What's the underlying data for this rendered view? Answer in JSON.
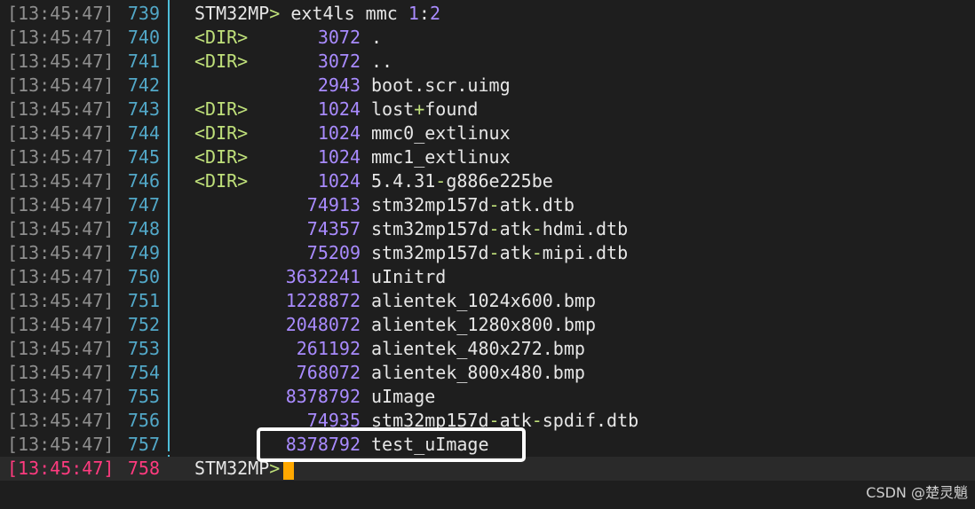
{
  "colors": {
    "background": "#1e1e1e",
    "timestamp": "#8f8f8f",
    "line_number": "#52a8c8",
    "current_line": "#ff3b7f",
    "dir_tag": "#bfe07a",
    "size": "#a98bff",
    "text": "#e6e6e6",
    "cursor": "#ffa800",
    "highlight_box": "#ffffff"
  },
  "command_line": {
    "timestamp": "[13:45:47]",
    "number": "739",
    "prompt": "STM32MP",
    "gt": ">",
    "command": " ext4ls mmc ",
    "arg_a": "1",
    "colon": ":",
    "arg_b": "2"
  },
  "entries": [
    {
      "timestamp": "[13:45:47]",
      "number": "740",
      "dir": "<DIR>",
      "size": "3072",
      "name": "."
    },
    {
      "timestamp": "[13:45:47]",
      "number": "741",
      "dir": "<DIR>",
      "size": "3072",
      "name": ".."
    },
    {
      "timestamp": "[13:45:47]",
      "number": "742",
      "dir": "",
      "size": "2943",
      "name": "boot.scr.uimg"
    },
    {
      "timestamp": "[13:45:47]",
      "number": "743",
      "dir": "<DIR>",
      "size": "1024",
      "name": "lost+found"
    },
    {
      "timestamp": "[13:45:47]",
      "number": "744",
      "dir": "<DIR>",
      "size": "1024",
      "name": "mmc0_extlinux"
    },
    {
      "timestamp": "[13:45:47]",
      "number": "745",
      "dir": "<DIR>",
      "size": "1024",
      "name": "mmc1_extlinux"
    },
    {
      "timestamp": "[13:45:47]",
      "number": "746",
      "dir": "<DIR>",
      "size": "1024",
      "name": "5.4.31-g886e225be"
    },
    {
      "timestamp": "[13:45:47]",
      "number": "747",
      "dir": "",
      "size": "74913",
      "name": "stm32mp157d-atk.dtb"
    },
    {
      "timestamp": "[13:45:47]",
      "number": "748",
      "dir": "",
      "size": "74357",
      "name": "stm32mp157d-atk-hdmi.dtb"
    },
    {
      "timestamp": "[13:45:47]",
      "number": "749",
      "dir": "",
      "size": "75209",
      "name": "stm32mp157d-atk-mipi.dtb"
    },
    {
      "timestamp": "[13:45:47]",
      "number": "750",
      "dir": "",
      "size": "3632241",
      "name": "uInitrd"
    },
    {
      "timestamp": "[13:45:47]",
      "number": "751",
      "dir": "",
      "size": "1228872",
      "name": "alientek_1024x600.bmp"
    },
    {
      "timestamp": "[13:45:47]",
      "number": "752",
      "dir": "",
      "size": "2048072",
      "name": "alientek_1280x800.bmp"
    },
    {
      "timestamp": "[13:45:47]",
      "number": "753",
      "dir": "",
      "size": "261192",
      "name": "alientek_480x272.bmp"
    },
    {
      "timestamp": "[13:45:47]",
      "number": "754",
      "dir": "",
      "size": "768072",
      "name": "alientek_800x480.bmp"
    },
    {
      "timestamp": "[13:45:47]",
      "number": "755",
      "dir": "",
      "size": "8378792",
      "name": "uImage"
    },
    {
      "timestamp": "[13:45:47]",
      "number": "756",
      "dir": "",
      "size": "74935",
      "name": "stm32mp157d-atk-spdif.dtb"
    },
    {
      "timestamp": "[13:45:47]",
      "number": "757",
      "dir": "",
      "size": "8378792",
      "name": "test_uImage"
    }
  ],
  "current_line": {
    "timestamp": "[13:45:47]",
    "number": "758",
    "prompt": "STM32MP",
    "gt": ">"
  },
  "watermark": "CSDN @楚灵魈"
}
